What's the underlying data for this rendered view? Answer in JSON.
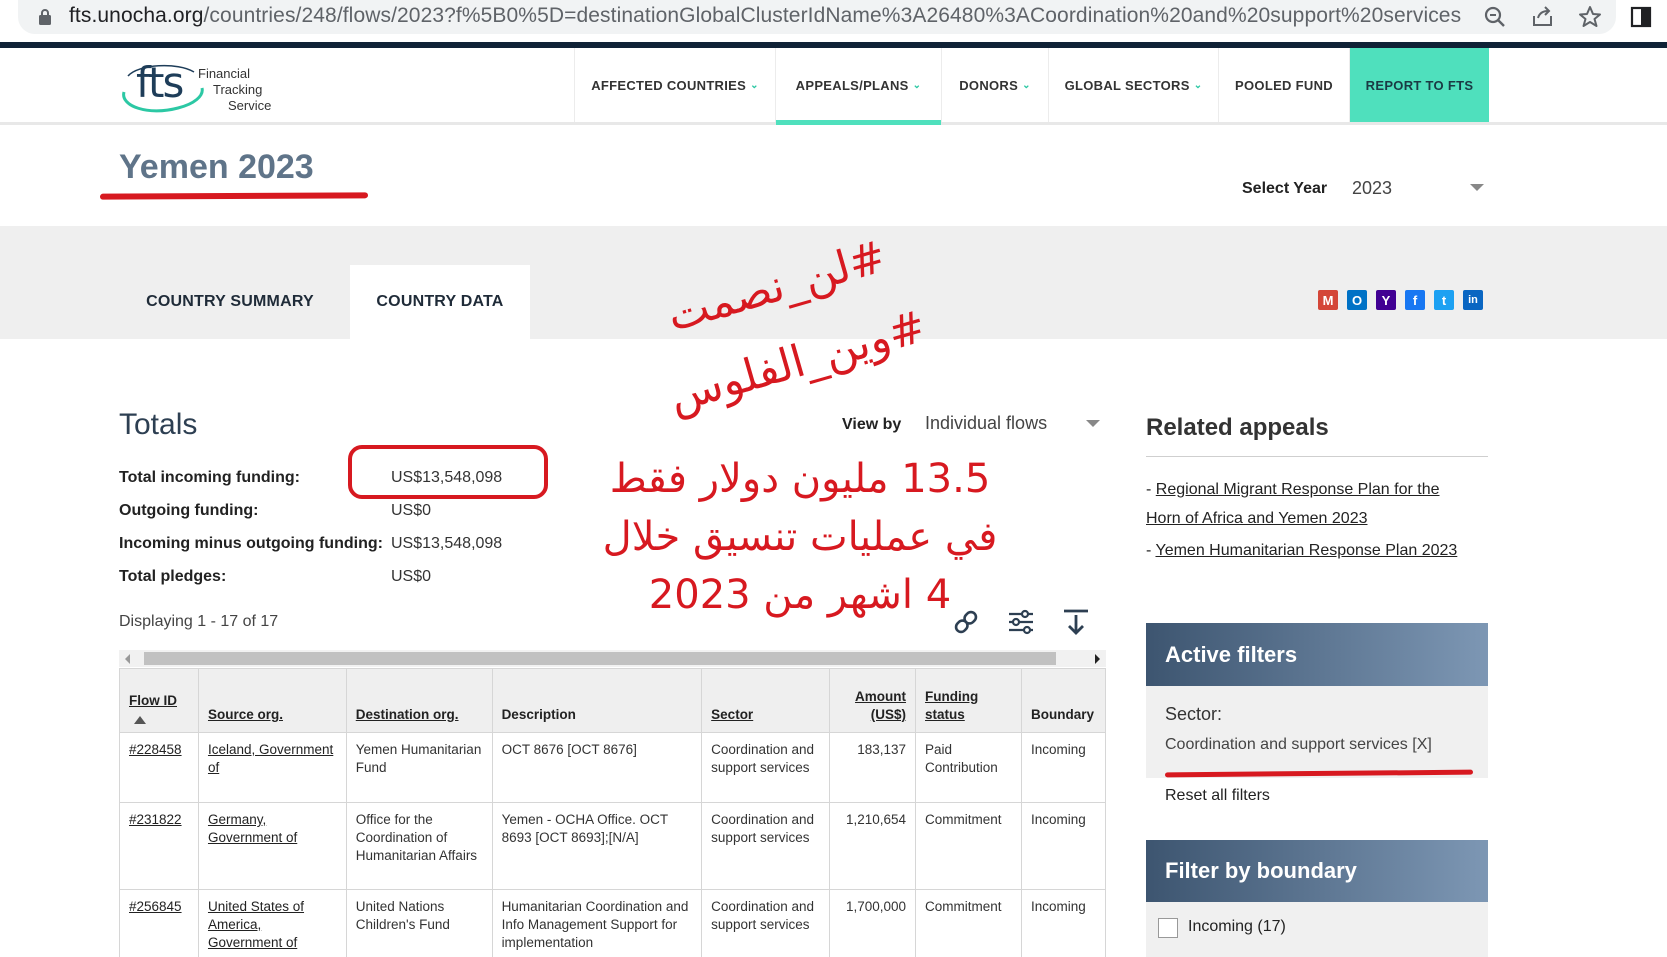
{
  "browser": {
    "url_host": "fts.unocha.org",
    "url_path": "/countries/248/flows/2023?f%5B0%5D=destinationGlobalClusterIdName%3A26480%3ACoordination%20and%20support%20services"
  },
  "logo": {
    "mark": "fts",
    "line1": "Financial",
    "line2": "Tracking",
    "line3": "Service"
  },
  "nav": {
    "items": [
      {
        "label": "AFFECTED COUNTRIES",
        "has_dropdown": true
      },
      {
        "label": "APPEALS/PLANS",
        "has_dropdown": true,
        "active": true
      },
      {
        "label": "DONORS",
        "has_dropdown": true
      },
      {
        "label": "GLOBAL SECTORS",
        "has_dropdown": true
      },
      {
        "label": "POOLED FUND",
        "has_dropdown": false
      },
      {
        "label": "REPORT TO FTS",
        "has_dropdown": false
      }
    ],
    "chevron": "⌄"
  },
  "page": {
    "title": "Yemen 2023",
    "year_label": "Select Year",
    "year_value": "2023"
  },
  "tabs": [
    {
      "label": "COUNTRY SUMMARY",
      "active": false
    },
    {
      "label": "COUNTRY DATA",
      "active": true
    }
  ],
  "share_icons": [
    {
      "name": "gmail-icon",
      "glyph": "M",
      "color": "#d44638"
    },
    {
      "name": "outlook-icon",
      "glyph": "O",
      "color": "#0072c6"
    },
    {
      "name": "yahoo-icon",
      "glyph": "Y",
      "color": "#410093"
    },
    {
      "name": "facebook-icon",
      "glyph": "f",
      "color": "#1877f2"
    },
    {
      "name": "twitter-icon",
      "glyph": "t",
      "color": "#1da1f2"
    },
    {
      "name": "linkedin-icon",
      "glyph": "in",
      "color": "#0a66c2"
    }
  ],
  "annotations": {
    "hashtag1": "#لن_نصمت",
    "hashtag2": "#وين_الفلوس",
    "note_line1": "13.5 مليون دولار فقط",
    "note_line2": "في عمليات تنسيق خلال",
    "note_line3": "4 اشهر من 2023"
  },
  "totals": {
    "heading": "Totals",
    "view_by_label": "View by",
    "view_by_value": "Individual flows",
    "rows": [
      {
        "label": "Total incoming funding:",
        "value": "US$13,548,098"
      },
      {
        "label": "Outgoing funding:",
        "value": "US$0"
      },
      {
        "label": "Incoming minus outgoing funding:",
        "value": "US$13,548,098"
      },
      {
        "label": "Total pledges:",
        "value": "US$0"
      }
    ],
    "displaying": "Displaying 1 - 17 of 17"
  },
  "tools": [
    "link-icon",
    "filter-settings-icon",
    "download-icon"
  ],
  "table": {
    "headers": [
      "Flow ID",
      "Source org.",
      "Destination org.",
      "Description",
      "Sector",
      "Amount (US$)",
      "Funding status",
      "Boundary"
    ],
    "rows": [
      {
        "flow_id": "#228458",
        "source": "Iceland, Government of",
        "destination": "Yemen Humanitarian Fund",
        "description": "OCT 8676 [OCT 8676]",
        "sector": "Coordination and support services",
        "amount": "183,137",
        "status": "Paid Contribution",
        "boundary": "Incoming"
      },
      {
        "flow_id": "#231822",
        "source": "Germany, Government of",
        "destination": "Office for the Coordination of Humanitarian Affairs",
        "description": "Yemen - OCHA Office. OCT 8693 [OCT 8693];[N/A]",
        "sector": "Coordination and support services",
        "amount": "1,210,654",
        "status": "Commitment",
        "boundary": "Incoming"
      },
      {
        "flow_id": "#256845",
        "source": "United States of America, Government of",
        "destination": "United Nations Children's Fund",
        "description": "Humanitarian Coordination and Info Management Support for implementation",
        "sector": "Coordination and support services",
        "amount": "1,700,000",
        "status": "Commitment",
        "boundary": "Incoming"
      }
    ]
  },
  "sidebar": {
    "related_heading": "Related appeals",
    "related": [
      "Regional Migrant Response Plan for the Horn of Africa and Yemen 2023",
      "Yemen Humanitarian Response Plan 2023"
    ],
    "related_prefix": "- ",
    "active_filters_heading": "Active filters",
    "sector_label": "Sector:",
    "sector_value": "Coordination and support services [X]",
    "reset_label": "Reset all filters",
    "boundary_heading": "Filter by boundary",
    "boundary_option": "Incoming (17)"
  },
  "colors": {
    "accent": "#4fe0bd",
    "title": "#5f7489",
    "annotation_red": "#d71920",
    "panel_dark": "#3d5570"
  }
}
